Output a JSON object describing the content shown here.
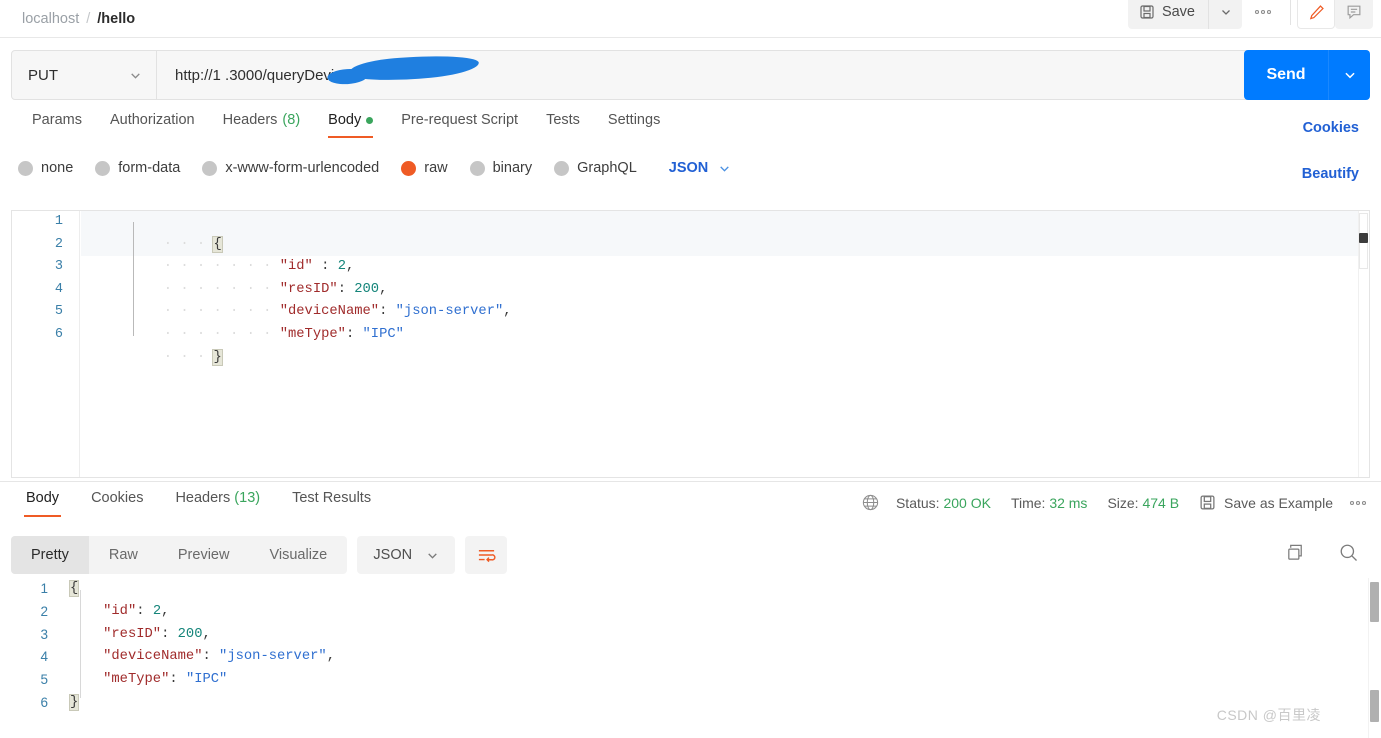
{
  "breadcrumb": {
    "collection": "localhost",
    "separator": "/",
    "request": "/hello"
  },
  "top_actions": {
    "save_label": "Save",
    "save_caret_icon": "chevron-down-icon",
    "more_icon": "ellipsis-icon",
    "edit_icon": "pencil-icon",
    "comment_icon": "comment-icon",
    "accent_orange": "#ef5b25"
  },
  "request": {
    "method": "PUT",
    "method_caret_icon": "chevron-down-icon",
    "url": "http://1           .3000/queryDevice/2",
    "url_visible_prefix": "http://1",
    "url_visible_suffix": ".3000/queryDevice/2",
    "url_redacted": true,
    "redaction_color": "#1f7fe0",
    "send_label": "Send",
    "send_caret_icon": "chevron-down-icon",
    "send_color": "#007bff"
  },
  "request_tabs": [
    {
      "label": "Params",
      "active": false
    },
    {
      "label": "Authorization",
      "active": false
    },
    {
      "label": "Headers",
      "count": "(8)",
      "active": false
    },
    {
      "label": "Body",
      "active": true,
      "dot": true
    },
    {
      "label": "Pre-request Script",
      "active": false
    },
    {
      "label": "Tests",
      "active": false
    },
    {
      "label": "Settings",
      "active": false
    }
  ],
  "links": {
    "cookies": "Cookies",
    "beautify": "Beautify"
  },
  "body_types": [
    {
      "label": "none",
      "selected": false
    },
    {
      "label": "form-data",
      "selected": false
    },
    {
      "label": "x-www-form-urlencoded",
      "selected": false
    },
    {
      "label": "raw",
      "selected": true
    },
    {
      "label": "binary",
      "selected": false
    },
    {
      "label": "GraphQL",
      "selected": false
    }
  ],
  "body_format": {
    "label": "JSON",
    "caret_icon": "chevron-down-icon"
  },
  "request_body": {
    "line_numbers": [
      "1",
      "2",
      "3",
      "4",
      "5",
      "6"
    ],
    "lines": [
      {
        "n": "1",
        "text": "{",
        "kind": "open-brace"
      },
      {
        "n": "2",
        "text": "\"id\" : 2,",
        "key": "\"id\"",
        "colon": " : ",
        "value": "2",
        "value_type": "number",
        "trail": ","
      },
      {
        "n": "3",
        "text": "\"resID\": 200,",
        "key": "\"resID\"",
        "colon": ": ",
        "value": "200",
        "value_type": "number",
        "trail": ","
      },
      {
        "n": "4",
        "text": "\"deviceName\": \"json-server\",",
        "key": "\"deviceName\"",
        "colon": ": ",
        "value": "\"json-server\"",
        "value_type": "string",
        "trail": ","
      },
      {
        "n": "5",
        "text": "\"meType\": \"IPC\"",
        "key": "\"meType\"",
        "colon": ": ",
        "value": "\"IPC\"",
        "value_type": "string",
        "trail": ""
      },
      {
        "n": "6",
        "text": "}",
        "kind": "close-brace"
      }
    ]
  },
  "response_tabs": [
    {
      "label": "Body",
      "active": true
    },
    {
      "label": "Cookies",
      "active": false
    },
    {
      "label": "Headers",
      "count": "(13)",
      "active": false
    },
    {
      "label": "Test Results",
      "active": false
    }
  ],
  "response_meta": {
    "globe_icon": "globe-icon",
    "status_label": "Status:",
    "status_value": "200 OK",
    "time_label": "Time:",
    "time_value": "32 ms",
    "size_label": "Size:",
    "size_value": "474 B",
    "save_example_icon": "save-icon",
    "save_example_label": "Save as Example",
    "more_icon": "ellipsis-icon",
    "value_color": "#3aa55d"
  },
  "response_view": {
    "modes": [
      {
        "label": "Pretty",
        "active": true
      },
      {
        "label": "Raw",
        "active": false
      },
      {
        "label": "Preview",
        "active": false
      },
      {
        "label": "Visualize",
        "active": false
      }
    ],
    "format": "JSON",
    "format_caret_icon": "chevron-down-icon",
    "wrap_icon": "word-wrap-icon",
    "copy_icon": "copy-icon",
    "search_icon": "search-icon"
  },
  "response_body": {
    "lines": [
      {
        "n": "1",
        "text": "{",
        "kind": "open-brace"
      },
      {
        "n": "2",
        "key": "\"id\"",
        "colon": ": ",
        "value": "2",
        "value_type": "number",
        "trail": ","
      },
      {
        "n": "3",
        "key": "\"resID\"",
        "colon": ": ",
        "value": "200",
        "value_type": "number",
        "trail": ","
      },
      {
        "n": "4",
        "key": "\"deviceName\"",
        "colon": ": ",
        "value": "\"json-server\"",
        "value_type": "string",
        "trail": ","
      },
      {
        "n": "5",
        "key": "\"meType\"",
        "colon": ": ",
        "value": "\"IPC\"",
        "value_type": "string",
        "trail": ""
      },
      {
        "n": "6",
        "text": "}",
        "kind": "close-brace"
      }
    ]
  },
  "watermark": "CSDN @百里凌"
}
